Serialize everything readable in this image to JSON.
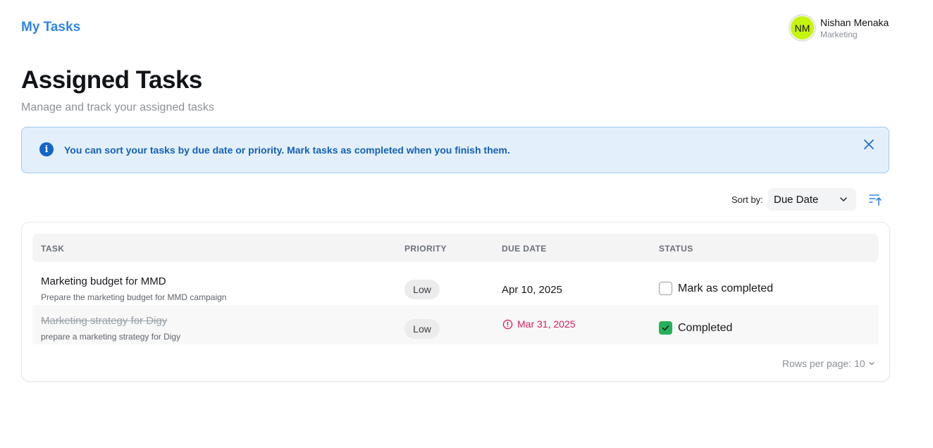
{
  "header": {
    "brand": "My Tasks",
    "user": {
      "initials": "NM",
      "name": "Nishan Menaka",
      "department": "Marketing",
      "avatar_color": "#c6f40a"
    }
  },
  "page": {
    "title": "Assigned Tasks",
    "subtitle": "Manage and track your assigned tasks"
  },
  "alert": {
    "icon": "info-icon",
    "text": "You can sort your tasks by due date or priority. Mark tasks as completed when you finish them.",
    "close_icon": "close-icon"
  },
  "sort": {
    "label": "Sort by:",
    "selected": "Due Date",
    "direction_icon": "sort-ascending-icon"
  },
  "table": {
    "columns": [
      "TASK",
      "PRIORITY",
      "DUE DATE",
      "STATUS"
    ],
    "rows": [
      {
        "title": "Marketing budget for MMD",
        "description": "Prepare the marketing budget for MMD campaign",
        "priority": "Low",
        "due_date": "Apr 10, 2025",
        "status": "Mark as completed",
        "completed": false,
        "overdue": false
      },
      {
        "title": "Marketing strategy for Digy",
        "description": "prepare a marketing strategy for Digy",
        "priority": "Low",
        "due_date": "Mar 31, 2025",
        "status": "Completed",
        "completed": true,
        "overdue": true
      }
    ]
  },
  "pagination": {
    "label": "Rows per page:",
    "value": "10"
  },
  "colors": {
    "accent": "#2f86e0",
    "overdue": "#d81e5b",
    "completed": "#24b15a",
    "alert_bg": "#e3f0fc"
  }
}
